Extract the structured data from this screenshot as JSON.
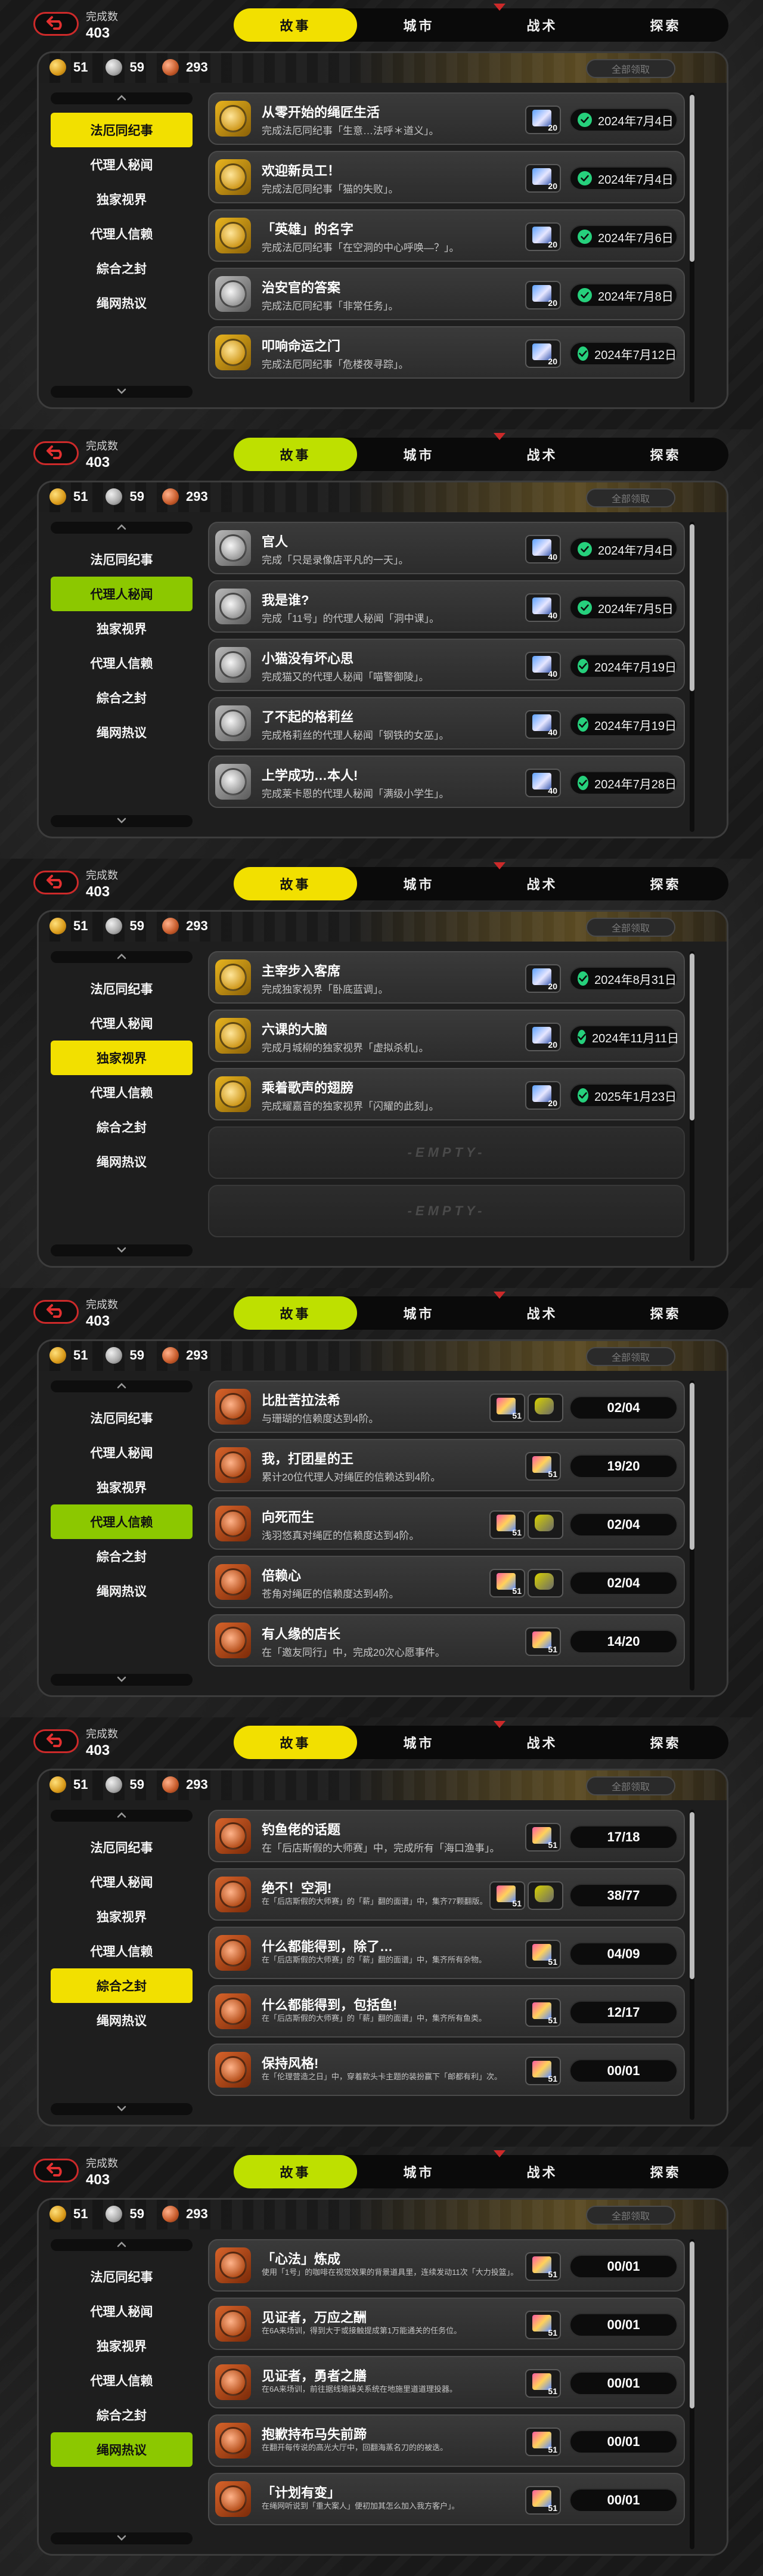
{
  "common": {
    "completion_label": "完成数",
    "completion_value": "403",
    "tabs": [
      "故事",
      "城市",
      "战术",
      "探索"
    ],
    "claim_all_label": "全部领取",
    "categories": [
      "法厄同纪事",
      "代理人秘闻",
      "独家视界",
      "代理人信赖",
      "綜合之封",
      "绳网热议"
    ],
    "currencies": [
      {
        "icon": "gold-medal-icon",
        "value": "51"
      },
      {
        "icon": "silver-medal-icon",
        "value": "59"
      },
      {
        "icon": "bronze-medal-icon",
        "value": "293"
      }
    ],
    "empty_label": "-EMPTY-"
  },
  "pages": [
    {
      "active_category": 0,
      "cards": [
        {
          "tier": "gold",
          "title": "从零开始的绳匠生活",
          "desc": "完成法厄同纪事「生意…法呼＊道义」。",
          "reward": "20",
          "date": "2024年7月4日"
        },
        {
          "tier": "gold",
          "title": "欢迎新员工！",
          "desc": "完成法厄同纪事「猫的失败」。",
          "reward": "20",
          "date": "2024年7月4日"
        },
        {
          "tier": "gold",
          "title": "「英雄」的名字",
          "desc": "完成法厄同纪事「在空洞的中心呼唤—？」。",
          "reward": "20",
          "date": "2024年7月6日"
        },
        {
          "tier": "silver",
          "title": "治安官的答案",
          "desc": "完成法厄同纪事「非常任务」。",
          "reward": "20",
          "date": "2024年7月8日"
        },
        {
          "tier": "gold",
          "title": "叩响命运之门",
          "desc": "完成法厄同纪事「危楼夜寻踪」。",
          "reward": "20",
          "date": "2024年7月12日"
        }
      ]
    },
    {
      "active_category": 1,
      "cards": [
        {
          "tier": "silver",
          "title": "官人",
          "desc": "完成「只是录像店平凡的一天」。",
          "reward": "40",
          "date": "2024年7月4日"
        },
        {
          "tier": "silver",
          "title": "我是谁?",
          "desc": "完成「11号」的代理人秘闻「洞中课」。",
          "reward": "40",
          "date": "2024年7月5日"
        },
        {
          "tier": "silver",
          "title": "小猫没有坏心思",
          "desc": "完成猫又的代理人秘闻「喵警御陵」。",
          "reward": "40",
          "date": "2024年7月19日"
        },
        {
          "tier": "silver",
          "title": "了不起的格莉丝",
          "desc": "完成格莉丝的代理人秘闻「钢铁的女巫」。",
          "reward": "40",
          "date": "2024年7月19日"
        },
        {
          "tier": "silver",
          "title": "上学成功…本人!",
          "desc": "完成莱卡恩的代理人秘闻「满级小学生」。",
          "reward": "40",
          "date": "2024年7月28日"
        }
      ]
    },
    {
      "active_category": 2,
      "cards": [
        {
          "tier": "gold",
          "title": "主宰步入客席",
          "desc": "完成独家视界「卧底蓝调」。",
          "reward": "20",
          "date": "2024年8月31日"
        },
        {
          "tier": "gold",
          "title": "六课的大脑",
          "desc": "完成月城柳的独家视界「虚拟杀机」。",
          "reward": "20",
          "date": "2024年11月11日"
        },
        {
          "tier": "gold",
          "title": "乘着歌声的翅膀",
          "desc": "完成耀嘉音的独家视界「闪耀的此刻」。",
          "reward": "20",
          "date": "2025年1月23日"
        }
      ],
      "empty_slots": 2
    },
    {
      "active_category": 3,
      "cards": [
        {
          "tier": "bronze",
          "title": "比肚苦拉法希",
          "desc": "与珊瑚的信赖度达到4阶。",
          "rewards": [
            "51",
            ""
          ],
          "progress": "02/04"
        },
        {
          "tier": "bronze",
          "title": "我，打团星的王",
          "desc": "累计20位代理人对绳匠的信赖达到4阶。",
          "rewards": [
            "51"
          ],
          "progress": "19/20"
        },
        {
          "tier": "bronze",
          "title": "向死而生",
          "desc": "浅羽悠真对绳匠的信赖度达到4阶。",
          "rewards": [
            "51",
            ""
          ],
          "progress": "02/04"
        },
        {
          "tier": "bronze",
          "title": "倍赖心",
          "desc": "苍角对绳匠的信赖度达到4阶。",
          "rewards": [
            "51",
            ""
          ],
          "progress": "02/04"
        },
        {
          "tier": "bronze",
          "title": "有人缘的店长",
          "desc": "在「邀友同行」中，完成20次心愿事件。",
          "rewards": [
            "51"
          ],
          "progress": "14/20"
        }
      ]
    },
    {
      "active_category": 4,
      "cards": [
        {
          "tier": "bronze",
          "title": "钓鱼佬的话题",
          "desc": "在「后店斯假的大师赛」中，完成所有「海口渔事」。",
          "small": false,
          "rewards": [
            "51"
          ],
          "progress": "17/18"
        },
        {
          "tier": "bronze",
          "title": "绝不！空洞!",
          "desc": "在「后店斯假的大师赛」的「薪」翻的面谱」中，集齐77颗翻版。",
          "small": true,
          "rewards": [
            "51",
            ""
          ],
          "progress": "38/77"
        },
        {
          "tier": "bronze",
          "title": "什么都能得到，除了…",
          "desc": "在「后店斯假的大师赛」的「薪」翻的面谱」中，集齐所有杂物。",
          "small": true,
          "rewards": [
            "51"
          ],
          "progress": "04/09"
        },
        {
          "tier": "bronze",
          "title": "什么都能得到，包括鱼!",
          "desc": "在「后店斯假的大师赛」的「薪」翻的面谱」中，集齐所有鱼类。",
          "small": true,
          "rewards": [
            "51"
          ],
          "progress": "12/17"
        },
        {
          "tier": "bronze",
          "title": "保持风格!",
          "desc": "在「伦理营造之日」中，穿着款头卡主题的装扮赢下「邮都有利」次。",
          "small": true,
          "rewards": [
            "51"
          ],
          "progress": "00/01"
        }
      ]
    },
    {
      "active_category": 5,
      "cards": [
        {
          "tier": "bronze",
          "title": "「心法」炼成",
          "desc": "使用「1号」的咖啡在视觉效果的背景道具里，连续发动11次「大力投篮」。",
          "small": true,
          "rewards": [
            "51"
          ],
          "progress": "00/01"
        },
        {
          "tier": "bronze",
          "title": "见证者，万应之酬",
          "desc": "在6A来场训，得到大于或接触提成第1万能通关的任务位。",
          "small": true,
          "rewards": [
            "51"
          ],
          "progress": "00/01"
        },
        {
          "tier": "bronze",
          "title": "见证者，勇者之膳",
          "desc": "在6A来场训，前往据线瑜操关系统在地施里道道理投器。",
          "small": true,
          "rewards": [
            "51"
          ],
          "progress": "00/01"
        },
        {
          "tier": "bronze",
          "title": "抱歉持布马失前蹄",
          "desc": "在翻开每传说的高光大厅中，回翻海蒸名刀的的被迭。",
          "small": true,
          "rewards": [
            "51"
          ],
          "progress": "00/01"
        },
        {
          "tier": "bronze",
          "title": "「计划有变」",
          "desc": "在绳网听说到「重大案人」便初加其怎么加入我方客户」。",
          "small": true,
          "rewards": [
            "51"
          ],
          "progress": "00/01"
        }
      ]
    }
  ]
}
